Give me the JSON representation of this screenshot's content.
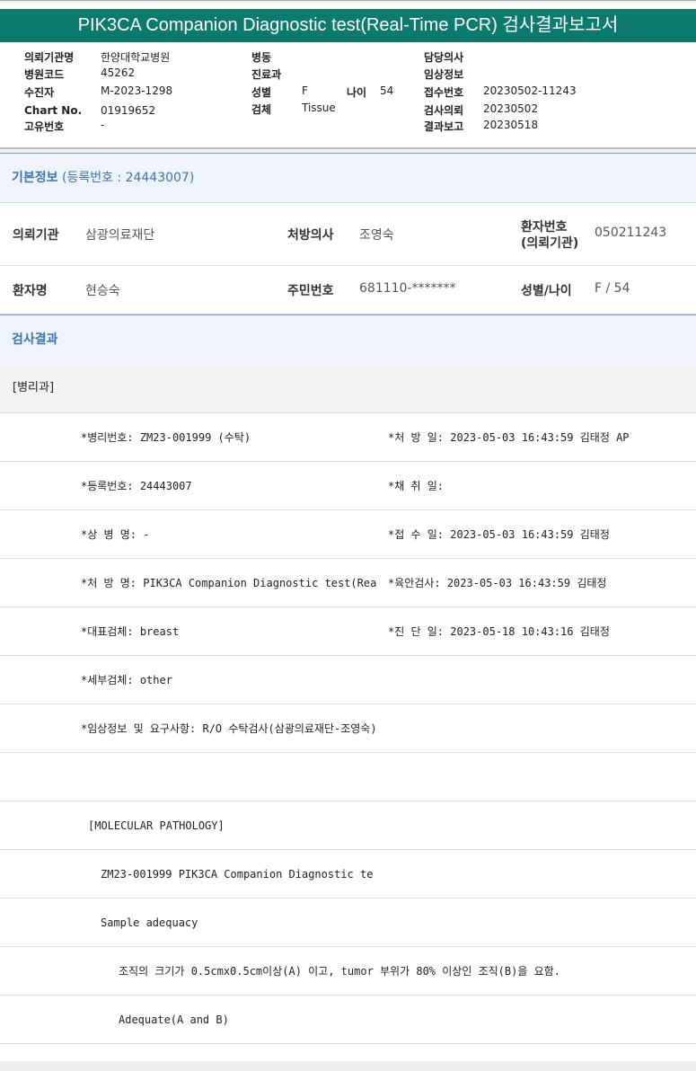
{
  "title": "PIK3CA Companion Diagnostic test(Real-Time PCR) 검사결과보고서",
  "header": {
    "col1": [
      {
        "label": "의뢰기관명",
        "value": "한양대학교병원"
      },
      {
        "label": "병원코드",
        "value": "45262"
      },
      {
        "label": "수진자",
        "value": "M-2023-1298"
      },
      {
        "label": "Chart No.",
        "value": "01919652"
      },
      {
        "label": "고유번호",
        "value": "-"
      }
    ],
    "col2": [
      {
        "label": "병동",
        "value": ""
      },
      {
        "label": "진료과",
        "value": ""
      },
      {
        "label": "성별",
        "value": "F"
      },
      {
        "label": "검체",
        "value": "Tissue"
      }
    ],
    "age": {
      "label": "나이",
      "value": "54"
    },
    "col3": [
      {
        "label": "담당의사",
        "value": ""
      },
      {
        "label": "임상정보",
        "value": ""
      },
      {
        "label": "접수번호",
        "value": "20230502-11243"
      },
      {
        "label": "검사의뢰",
        "value": "20230502"
      },
      {
        "label": "결과보고",
        "value": "20230518"
      }
    ]
  },
  "basic": {
    "title": "기본정보",
    "reg": "(등록번호 : 24443007)",
    "rows": [
      [
        {
          "label": "의뢰기관",
          "value": "삼광의료재단"
        },
        {
          "label": "처방의사",
          "value": "조영숙"
        },
        {
          "label": "환자번호",
          "label2": "(의뢰기관)",
          "value": "050211243"
        }
      ],
      [
        {
          "label": "환자명",
          "value": "현승숙"
        },
        {
          "label": "주민번호",
          "value": "681110-*******"
        },
        {
          "label": "성별/나이",
          "value": "F / 54"
        }
      ]
    ]
  },
  "result": {
    "title": "검사결과",
    "dept": "[병리과]",
    "rows": [
      {
        "left": "*병리번호: ZM23-001999 (수탁)",
        "right": "*처 방 일: 2023-05-03 16:43:59  김태정 AP"
      },
      {
        "left": "*등록번호: 24443007",
        "right": "*채 취 일:"
      },
      {
        "left": "*상 병 명: -",
        "right": "*접 수 일: 2023-05-03 16:43:59  김태정"
      },
      {
        "left": "*처 방 명: PIK3CA Companion Diagnostic test(Rea",
        "right": "*육안검사: 2023-05-03 16:43:59  김태정"
      },
      {
        "left": "*대표검체: breast",
        "right": "*진 단 일: 2023-05-18 10:43:16  김태정"
      },
      {
        "left": "*세부검체: other",
        "right": ""
      },
      {
        "left": "*임상정보 및 요구사항: R/O 수탁검사(삼광의료재단-조영숙)",
        "right": ""
      }
    ],
    "body": [
      "",
      "[MOLECULAR PATHOLOGY]",
      "ZM23-001999     PIK3CA Companion Diagnostic te",
      "Sample adequacy",
      "조직의 크기가 0.5cmx0.5cm이상(A) 이고, tumor 부위가 80% 이상인 조직(B)을 요함.",
      "Adequate(A and B)"
    ]
  }
}
